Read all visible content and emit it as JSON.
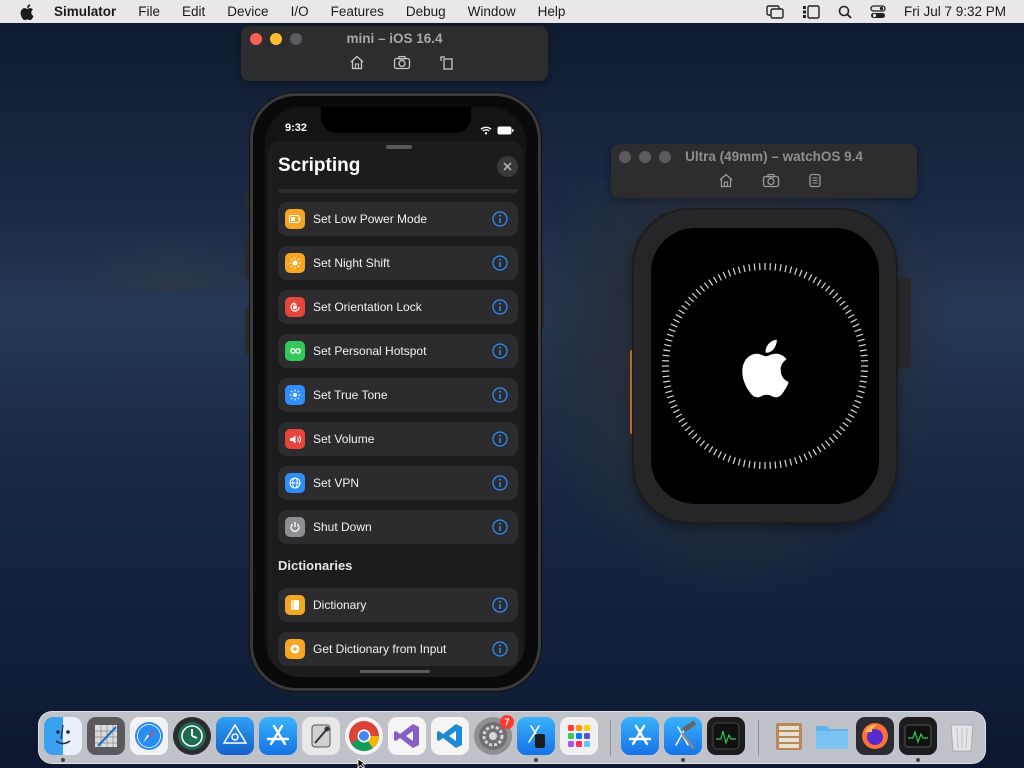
{
  "menubar": {
    "app_name": "Simulator",
    "items": [
      "File",
      "Edit",
      "Device",
      "I/O",
      "Features",
      "Debug",
      "Window",
      "Help"
    ],
    "clock": "Fri Jul 7  9:32 PM"
  },
  "iphone_window": {
    "title": "mini – iOS 16.4"
  },
  "watch_window": {
    "title": "Ultra (49mm) – watchOS 9.4"
  },
  "iphone": {
    "status_time": "9:32",
    "sheet_title": "Scripting",
    "rows": [
      {
        "label": "Set Low Power Mode",
        "icon": "battery-icon",
        "color": "#f5a623"
      },
      {
        "label": "Set Night Shift",
        "icon": "sun-icon",
        "color": "#f5a623"
      },
      {
        "label": "Set Orientation Lock",
        "icon": "orientation-lock-icon",
        "color": "#e5453b"
      },
      {
        "label": "Set Personal Hotspot",
        "icon": "hotspot-icon",
        "color": "#34c759"
      },
      {
        "label": "Set True Tone",
        "icon": "true-tone-icon",
        "color": "#2f8ef7"
      },
      {
        "label": "Set Volume",
        "icon": "speaker-icon",
        "color": "#e5453b"
      },
      {
        "label": "Set VPN",
        "icon": "globe-icon",
        "color": "#2f8ef7"
      },
      {
        "label": "Shut Down",
        "icon": "power-icon",
        "color": "#8e8e93"
      }
    ],
    "section_dictionaries": "Dictionaries",
    "dict_rows": [
      {
        "label": "Dictionary",
        "icon": "book-icon",
        "color": "#f5a623"
      },
      {
        "label": "Get Dictionary from Input",
        "icon": "gear-icon",
        "color": "#f5a623"
      }
    ]
  },
  "dock": {
    "apps": [
      "finder",
      "xcode-instruments",
      "safari",
      "time-machine",
      "testflight",
      "app-store",
      "system-toolkit",
      "chrome",
      "visual-studio",
      "vscode",
      "system-preferences",
      "simulator",
      "launchpad",
      "app-store-2",
      "xcode",
      "activity-monitor",
      "archive-utility",
      "folder",
      "firefox",
      "console",
      "trash"
    ],
    "badge": "7"
  }
}
